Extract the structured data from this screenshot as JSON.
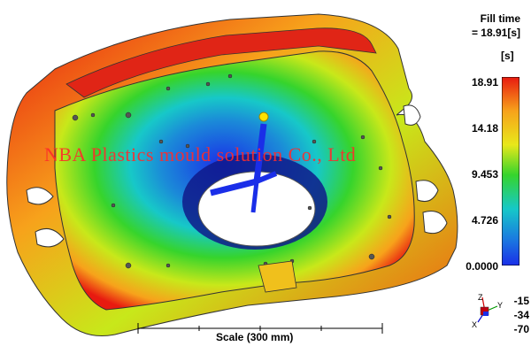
{
  "result": {
    "title": "Fill time",
    "value_line": "= 18.91[s]",
    "unit": "[s]",
    "ticks": [
      "18.91",
      "14.18",
      "9.453",
      "4.726",
      "0.0000"
    ],
    "colors": {
      "max": "#e81a10",
      "high": "#f7a21b",
      "mid_high": "#e8e81a",
      "mid": "#36d42c",
      "mid_low": "#16c8c8",
      "low": "#1a2ee8"
    }
  },
  "scale": {
    "label": "Scale (300 mm)"
  },
  "watermark": {
    "text": "NBA Plastics mould solution Co., Ltd"
  },
  "orientation": {
    "angles": [
      "-15",
      "-34",
      "-70"
    ],
    "axes": [
      "Z",
      "Y",
      "X"
    ]
  }
}
